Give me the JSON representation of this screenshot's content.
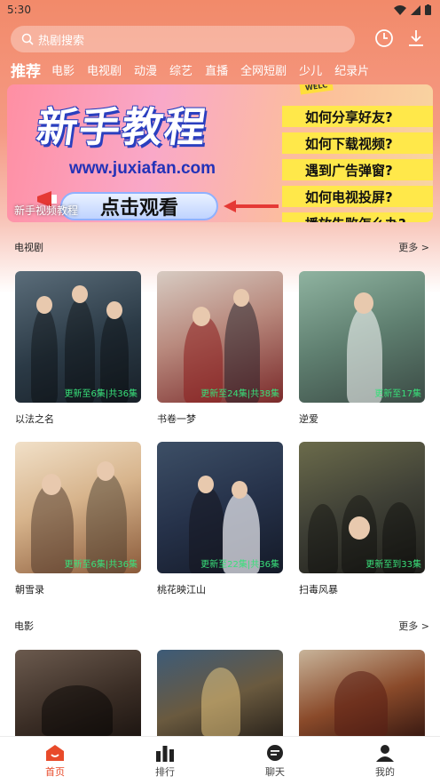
{
  "status": {
    "time": "5:30"
  },
  "search": {
    "placeholder": "热剧搜索"
  },
  "categories": [
    "推荐",
    "电影",
    "电视剧",
    "动漫",
    "综艺",
    "直播",
    "全网短剧",
    "少儿",
    "纪录片"
  ],
  "banner": {
    "title": "新手教程",
    "url": "www.juxiafan.com",
    "button": "点击观看",
    "tag": "新手视频教程",
    "welcome": "WELC",
    "faq": [
      "如何分享好友?",
      "如何下载视频?",
      "遇到广告弹窗?",
      "如何电视投屏?",
      "播放失败怎么办?"
    ]
  },
  "sections": [
    {
      "title": "电视剧",
      "more": "更多 >",
      "items": [
        {
          "title": "以法之名",
          "episode": "更新至6集|共36集"
        },
        {
          "title": "书卷一梦",
          "episode": "更新至24集|共38集"
        },
        {
          "title": "逆爱",
          "episode": "更新至17集"
        },
        {
          "title": "朝雪录",
          "episode": "更新至6集|共36集"
        },
        {
          "title": "桃花映江山",
          "episode": "更新至22集|共36集"
        },
        {
          "title": "扫毒风暴",
          "episode": "更新至到33集"
        }
      ]
    },
    {
      "title": "电影",
      "more": "更多 >",
      "items": [
        {
          "title": "",
          "episode": ""
        },
        {
          "title": "",
          "episode": ""
        },
        {
          "title": "",
          "episode": ""
        }
      ]
    }
  ],
  "nav": [
    {
      "label": "首页",
      "icon": "home-icon",
      "active": true
    },
    {
      "label": "排行",
      "icon": "ranking-icon",
      "active": false
    },
    {
      "label": "聊天",
      "icon": "chat-icon",
      "active": false
    },
    {
      "label": "我的",
      "icon": "profile-icon",
      "active": false
    }
  ],
  "colors": {
    "accent": "#e84a2a",
    "episode": "#39e07a",
    "header": "#f28a6a"
  }
}
